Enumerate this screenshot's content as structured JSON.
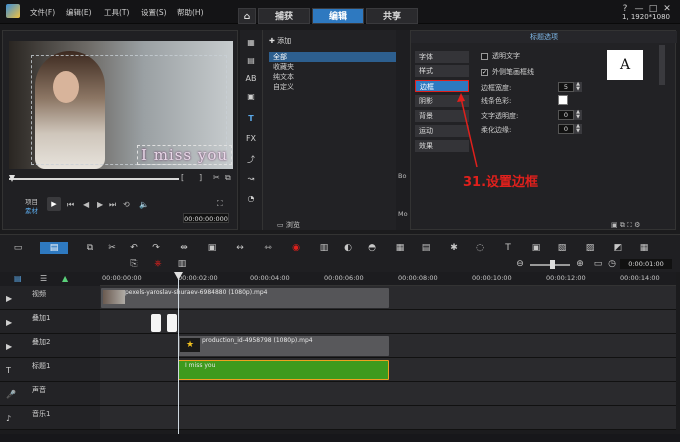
{
  "menubar": {
    "items": [
      "文件(F)",
      "编辑(E)",
      "工具(T)",
      "设置(S)",
      "帮助(H)"
    ],
    "tabs": [
      {
        "label": "捕获",
        "active": false
      },
      {
        "label": "编辑",
        "active": true
      },
      {
        "label": "共享",
        "active": false
      }
    ],
    "resolution": "1, 1920*1080",
    "window_buttons": [
      "?",
      "—",
      "□",
      "✕"
    ]
  },
  "preview": {
    "overlay_text": "I miss you",
    "mode_labels": [
      "项目",
      "素材"
    ],
    "bracket_left": "[",
    "bracket_right": "]",
    "timecode": "00:00:00:000"
  },
  "library": {
    "add_label": "添加",
    "items": [
      {
        "label": "全部",
        "selected": true
      },
      {
        "label": "收藏夹",
        "selected": false
      },
      {
        "label": "纯文本",
        "selected": false
      },
      {
        "label": "自定义",
        "selected": false
      }
    ],
    "browse_label": "浏览",
    "side_labels": [
      "Bo",
      "Mo"
    ]
  },
  "title_options": {
    "header": "标题选项",
    "tabs": [
      {
        "label": "字体",
        "active": false
      },
      {
        "label": "样式",
        "active": false
      },
      {
        "label": "边框",
        "active": true
      },
      {
        "label": "阴影",
        "active": false
      },
      {
        "label": "背景",
        "active": false
      },
      {
        "label": "运动",
        "active": false
      },
      {
        "label": "效果",
        "active": false
      }
    ],
    "transparent_text": {
      "label": "透明文字",
      "checked": false
    },
    "outer_stroke": {
      "label": "外侧笔画框线",
      "checked": true
    },
    "border_width": {
      "label": "边框宽度:",
      "value": "5"
    },
    "line_color": {
      "label": "线条色彩:",
      "value": "#ffffff"
    },
    "text_opacity": {
      "label": "文字透明度:",
      "value": "0"
    },
    "soft_edge": {
      "label": "柔化边缘:",
      "value": "0"
    },
    "preset_letter": "A",
    "annotation": "31.设置边框"
  },
  "timeline": {
    "ruler_labels": [
      "00:00:00:00",
      "00:00:02:00",
      "00:00:04:00",
      "00:00:06:00",
      "00:00:08:00",
      "00:00:10:00",
      "00:00:12:00",
      "00:00:14:00"
    ],
    "zoom_timecode": "0:00:01:00",
    "tracks": [
      {
        "name": "视频",
        "clip": "pexels-yaroslav-shuraev-6984880 (1080p).mp4"
      },
      {
        "name": "叠加1",
        "clip": ""
      },
      {
        "name": "叠加2",
        "clip": "production_id-4958798 (1080p).mp4"
      },
      {
        "name": "标题1",
        "clip": "I miss you"
      },
      {
        "name": "声音",
        "clip": ""
      },
      {
        "name": "音乐1",
        "clip": ""
      }
    ]
  },
  "colors": {
    "accent": "#2e79c0",
    "annotation_red": "#e0201c",
    "title_clip": "#3e9a1d"
  }
}
